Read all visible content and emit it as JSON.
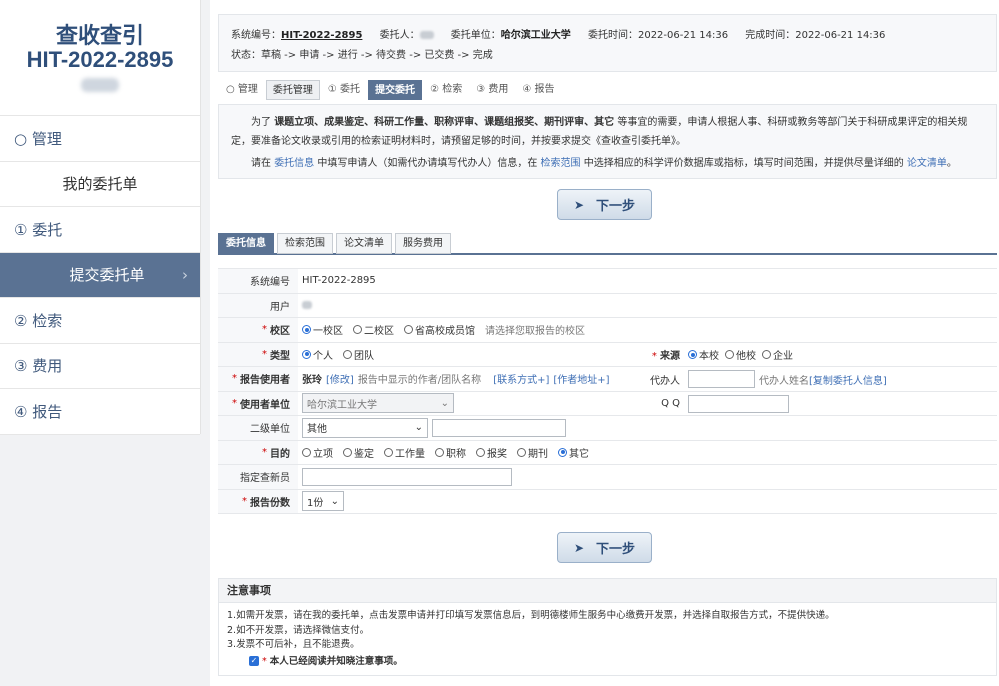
{
  "sidebar": {
    "title": "查收查引",
    "code": "HIT-2022-2895",
    "items": [
      {
        "label": "○ 管理"
      },
      {
        "label": "我的委托单"
      },
      {
        "label": "① 委托"
      },
      {
        "label": "提交委托单"
      },
      {
        "label": "② 检索"
      },
      {
        "label": "③ 费用"
      },
      {
        "label": "④ 报告"
      }
    ]
  },
  "info": {
    "sysno_label": "系统编号：",
    "sysno": "HIT-2022-2895",
    "client_label": "委托人：",
    "unit_label": "委托单位：",
    "unit": "哈尔滨工业大学",
    "time_label": "委托时间：",
    "time": "2022-06-21 14:36",
    "done_label": "完成时间：",
    "done": "2022-06-21 14:36",
    "status_label": "状态：",
    "status": "草稿 -> 申请 -> 进行 -> 待交费 -> 已交费 -> 完成"
  },
  "steps": [
    "○ 管理",
    "委托管理",
    "① 委托",
    "提交委托",
    "② 检索",
    "③ 费用",
    "④ 报告"
  ],
  "notice_top": {
    "p1a": "为了 ",
    "p1b": "课题立项、成果鉴定、科研工作量、职称评审、课题组报奖、期刊评审、其它",
    "p1c": " 等事宜的需要，申请人根据人事、科研或教务等部门关于科研成果评定的相关规定，要准备论文收录或引用的检索证明材料时，请预留足够的时间，并按要求提交《查收查引委托单》。",
    "p2a": "请在 ",
    "p2b": "委托信息",
    "p2c": " 中填写申请人（如需代办请填写代办人）信息，在 ",
    "p2d": "检索范围",
    "p2e": " 中选择相应的科学评价数据库或指标，填写时间范围，并提供尽量详细的 ",
    "p2f": "论文清单",
    "p2g": "。"
  },
  "next_label": "下一步",
  "tabs": [
    "委托信息",
    "检索范围",
    "论文清单",
    "服务费用"
  ],
  "form": {
    "sysno_label": "系统编号",
    "sysno": "HIT-2022-2895",
    "user_label": "用户",
    "campus_label": "校区",
    "campus_opts": [
      "一校区",
      "二校区",
      "省高校成员馆"
    ],
    "campus_hint": "请选择您取报告的校区",
    "type_label": "类型",
    "type_opts": [
      "个人",
      "团队"
    ],
    "source_label": "来源",
    "source_opts": [
      "本校",
      "他校",
      "企业"
    ],
    "report_user_label": "报告使用者",
    "report_user": "张玲",
    "modify": "[修改]",
    "report_user_hint": "报告中显示的作者/团队名称",
    "contact": "[联系方式+]",
    "author_addr": "[作者地址+]",
    "agent_label": "代办人",
    "agent_hint": "代办人姓名",
    "copy_client": "[复制委托人信息]",
    "org_label": "使用者单位",
    "org": "哈尔滨工业大学",
    "qq_label": "Q Q",
    "sub_unit_label": "二级单位",
    "sub_unit": "其他",
    "purpose_label": "目的",
    "purpose_opts": [
      "立项",
      "鉴定",
      "工作量",
      "职称",
      "报奖",
      "期刊",
      "其它"
    ],
    "assign_label": "指定查新员",
    "copies_label": "报告份数",
    "copies": "1份"
  },
  "notice": {
    "title": "注意事项",
    "l1": "1.如需开发票，请在我的委托单，点击发票申请并打印填写发票信息后，到明德楼师生服务中心缴费开发票，并选择自取报告方式，不提供快递。",
    "l2": "2.如不开发票，请选择微信支付。",
    "l3": "3.发票不可后补，且不能退费。",
    "agree": "本人已经阅读并知晓注意事项。"
  }
}
